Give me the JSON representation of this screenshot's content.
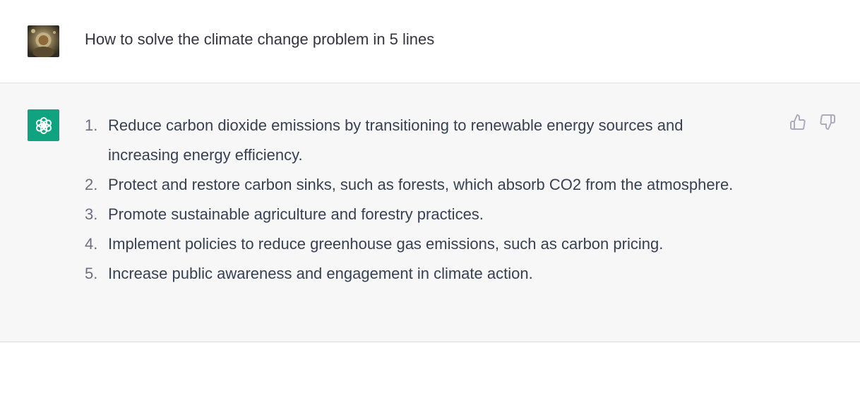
{
  "user_message": {
    "text": "How to solve the climate change problem in 5 lines",
    "avatar": "user-avatar-image"
  },
  "assistant_message": {
    "avatar": "openai-logo-icon",
    "items": [
      {
        "num": "1.",
        "text": "Reduce carbon dioxide emissions by transitioning to renewable energy sources and increasing energy efficiency."
      },
      {
        "num": "2.",
        "text": "Protect and restore carbon sinks, such as forests, which absorb CO2 from the atmosphere."
      },
      {
        "num": "3.",
        "text": "Promote sustainable agriculture and forestry practices."
      },
      {
        "num": "4.",
        "text": "Implement policies to reduce greenhouse gas emissions, such as carbon pricing."
      },
      {
        "num": "5.",
        "text": "Increase public awareness and engagement in climate action."
      }
    ],
    "feedback": {
      "like_icon": "thumbs-up-icon",
      "dislike_icon": "thumbs-down-icon"
    }
  },
  "colors": {
    "assistant_bg": "#f7f7f8",
    "brand": "#10a37f",
    "text": "#374151"
  }
}
